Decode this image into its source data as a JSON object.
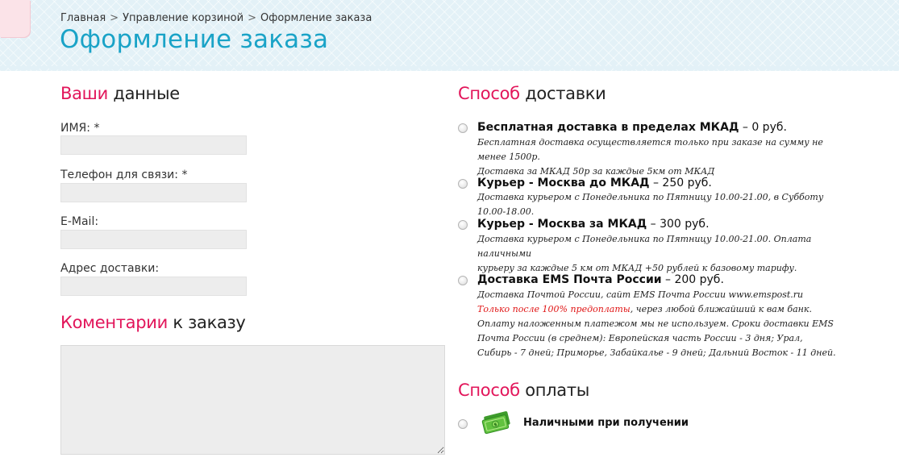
{
  "breadcrumb": [
    "Главная",
    "Управление корзиной",
    "Оформление заказа"
  ],
  "breadcrumb_separator": ">",
  "page_title": "Оформление заказа",
  "colors": {
    "accent": "#e2155a",
    "title": "#1aa3c7",
    "header_bg": "#e3f1f7"
  },
  "personal": {
    "title_accent": "Ваши",
    "title_rest": "данные",
    "fields": [
      {
        "label": "ИМЯ: *",
        "value": ""
      },
      {
        "label": "Телефон для связи: *",
        "value": ""
      },
      {
        "label": "E-Mail:",
        "value": ""
      },
      {
        "label": "Адрес доставки:",
        "value": ""
      }
    ]
  },
  "comments": {
    "title_accent": "Коментарии",
    "title_rest": "к заказу",
    "value": ""
  },
  "delivery": {
    "title_accent": "Способ",
    "title_rest": "доставки",
    "options": [
      {
        "name": "Бесплатная доставка в пределах МКАД",
        "price": " – 0 руб.",
        "desc": [
          "Бесплатная доставка осуществляется только при заказе на сумму не менее 1500р.",
          "Доставка за МКАД 50р за каждые 5км от МКАД"
        ]
      },
      {
        "name": "Курьер - Москва до МКАД",
        "price": " – 250 руб.",
        "desc": [
          "Доставка курьером с Понедельника по Пятницу 10.00-21.00, в Субботу 10.00-18.00."
        ]
      },
      {
        "name": "Курьер - Москва за МКАД",
        "price": " – 300 руб.",
        "desc": [
          "Доставка курьером с Понедельника по Пятницу 10.00-21.00. Оплата наличными",
          "курьеру за каждые 5 км от МКАД +50 рублей к базовому тарифу."
        ]
      },
      {
        "name": "Доставка EMS Почта России",
        "price": " – 200 руб.",
        "desc_pre": "Доставка Почтой России, сайт EMS Почта России www.emspost.ru ",
        "desc_red": "Только после 100% предоплаты",
        "desc_post": ", через любой ближайший к вам банк. Оплату наложенным платежом мы не используем. Сроки доставки EMS Почта России (в среднем): Европейская часть России - 3 дня; Урал, Сибирь - 7 дней; Приморье, Забайкалье - 9 дней; Дальний Восток - 11 дней."
      }
    ]
  },
  "payment": {
    "title_accent": "Способ",
    "title_rest": "оплаты",
    "options": [
      {
        "label": "Наличными при получении",
        "icon": "cash-icon"
      }
    ]
  }
}
